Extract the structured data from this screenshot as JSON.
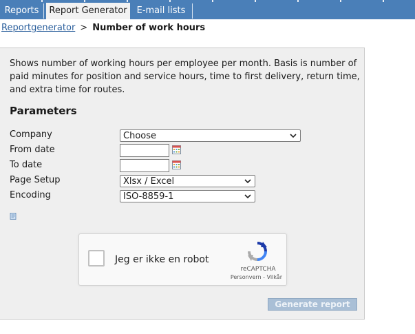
{
  "nav": {
    "tabs": [
      {
        "label": "Reports",
        "active": false
      },
      {
        "label": "Report Generator",
        "active": true
      },
      {
        "label": "E-mail lists",
        "active": false
      }
    ]
  },
  "breadcrumb": {
    "link": "Reportgenerator",
    "separator": ">",
    "current": "Number of work hours"
  },
  "description": "Shows number of working hours per employee per month. Basis is number of paid minutes for position and service hours, time to first delivery, return time, and extra time for routes.",
  "parameters": {
    "title": "Parameters",
    "company": {
      "label": "Company",
      "value": "Choose"
    },
    "from_date": {
      "label": "From date",
      "value": ""
    },
    "to_date": {
      "label": "To date",
      "value": ""
    },
    "page_setup": {
      "label": "Page Setup",
      "value": "Xlsx / Excel"
    },
    "encoding": {
      "label": "Encoding",
      "value": "ISO-8859-1"
    }
  },
  "captcha": {
    "checkbox_label": "Jeg er ikke en robot",
    "brand": "reCAPTCHA",
    "terms": "Personvern - Vilkår"
  },
  "generate_button": "Generate report",
  "colors": {
    "nav_bg": "#4a7fb8",
    "link": "#2b5f9c",
    "panel_bg": "#efefef",
    "button_disabled_bg": "#a9bfd6"
  },
  "icons": {
    "calendar": "calendar-icon",
    "dropdown": "chevron-down-icon",
    "document": "document-icon",
    "captcha_logo": "recaptcha-logo-icon"
  }
}
